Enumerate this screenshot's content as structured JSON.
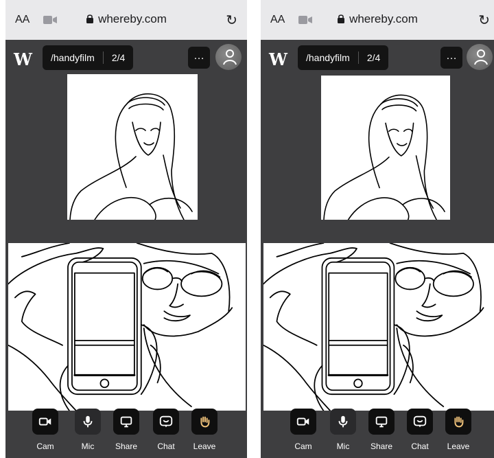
{
  "browser": {
    "text_size_label": "AA",
    "camera_indicator_icon": "video-camera-icon",
    "host": "whereby.com",
    "lock_icon": "lock-icon",
    "reload_icon": "reload-icon"
  },
  "header": {
    "logo_text": "W",
    "room_name": "/handyfilm",
    "participant_count": "2/4",
    "more_label": "…"
  },
  "toolbar": [
    {
      "name": "cam",
      "label": "Cam",
      "icon": "video-camera-icon"
    },
    {
      "name": "mic",
      "label": "Mic",
      "icon": "microphone-icon"
    },
    {
      "name": "share",
      "label": "Share",
      "icon": "screen-share-icon"
    },
    {
      "name": "chat",
      "label": "Chat",
      "icon": "chat-icon"
    },
    {
      "name": "leave",
      "label": "Leave",
      "icon": "waving-hand-icon"
    }
  ],
  "colors": {
    "app_background": "#3e3e40",
    "url_bar": "#e9e9eb",
    "button_background": "#0f0f0f"
  }
}
